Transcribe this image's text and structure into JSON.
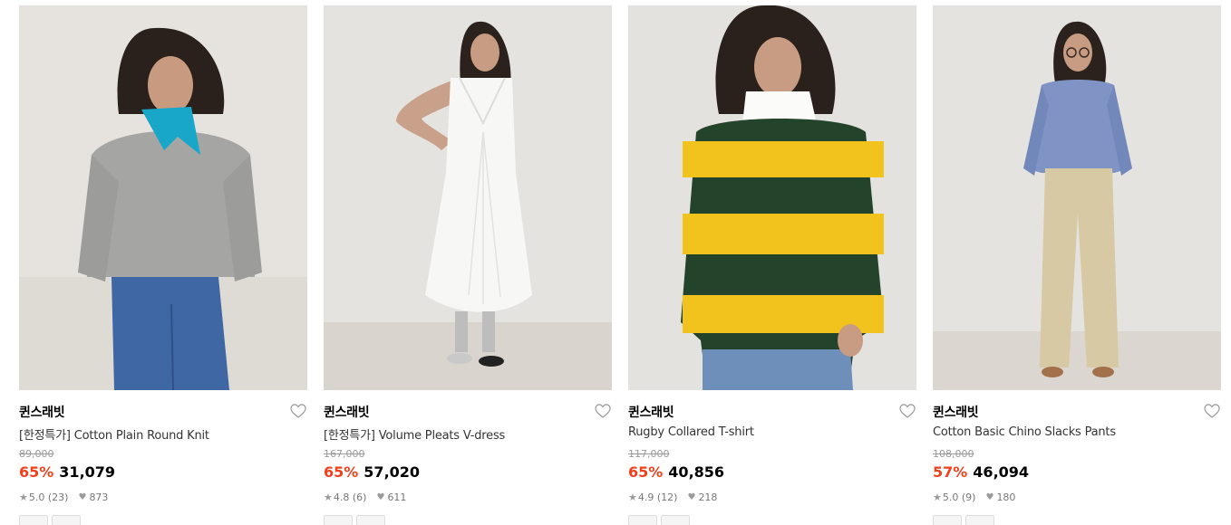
{
  "products": [
    {
      "brand": "퀸스래빗",
      "name": "[한정특가] Cotton Plain Round Knit",
      "original_price": "89,000",
      "discount": "65%",
      "price": "31,079",
      "rating": "5.0",
      "reviews": "(23)",
      "likes": "873",
      "photo_alt": "Model wearing grey round knit sweater with blue bandana and wide jeans"
    },
    {
      "brand": "퀸스래빗",
      "name": "[한정특가] Volume Pleats V-dress",
      "original_price": "167,000",
      "discount": "65%",
      "price": "57,020",
      "rating": "4.8",
      "reviews": "(6)",
      "likes": "611",
      "photo_alt": "Model wearing white sleeveless pleated V-neck midi dress with socks and silver shoes"
    },
    {
      "brand": "퀸스래빗",
      "name": "Rugby Collared T-shirt",
      "original_price": "117,000",
      "discount": "65%",
      "price": "40,856",
      "rating": "4.9",
      "reviews": "(12)",
      "likes": "218",
      "photo_alt": "Model wearing green and yellow striped rugby collared shirt"
    },
    {
      "brand": "퀸스래빗",
      "name": "Cotton Basic Chino Slacks Pants",
      "original_price": "108,000",
      "discount": "57%",
      "price": "46,094",
      "rating": "5.0",
      "reviews": "(9)",
      "likes": "180",
      "photo_alt": "Model wearing blue striped shirt, glasses and beige chino slacks"
    }
  ],
  "icons": {
    "wishlist": "heart-outline-icon",
    "rating": "star-icon",
    "likes": "heart-filled-icon"
  },
  "colors": {
    "discount": "#f23f1c",
    "background": "#ffffff",
    "photo_bg": "#e7e4df"
  }
}
